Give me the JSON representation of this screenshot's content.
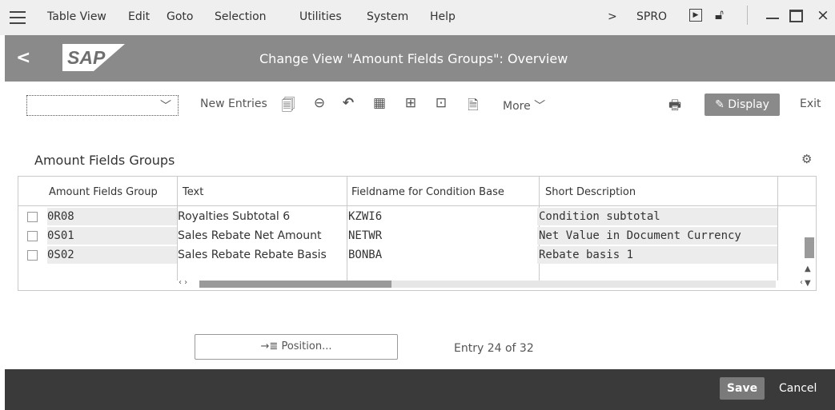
{
  "menu": {
    "items": [
      "Table View",
      "Edit",
      "Goto",
      "Selection",
      "Utilities",
      "System",
      "Help"
    ],
    "tcode": "SPRO",
    "chevron": ">"
  },
  "header": {
    "back": "<",
    "logo_text": "SAP",
    "title": "Change View \"Amount Fields Groups\": Overview"
  },
  "toolbar": {
    "new_entries": "New Entries",
    "more": "More",
    "display": "Display",
    "exit": "Exit",
    "select_value": ""
  },
  "section": {
    "title": "Amount Fields Groups"
  },
  "table": {
    "columns": [
      "Amount Fields Group",
      "Text",
      "Fieldname for Condition Base",
      "Short Description"
    ],
    "rows": [
      {
        "group": "0R08",
        "text": "Royalties Subtotal 6",
        "field": "KZWI6",
        "desc": "Condition subtotal"
      },
      {
        "group": "0S01",
        "text": "Sales Rebate Net Amount",
        "field": "NETWR",
        "desc": "Net Value in Document Currency"
      },
      {
        "group": "0S02",
        "text": "Sales Rebate Rebate Basis",
        "field": "BONBA",
        "desc": "Rebate basis 1"
      }
    ]
  },
  "position_button": "Position...",
  "entry_info": "Entry 24 of 32",
  "footer": {
    "save": "Save",
    "cancel": "Cancel"
  },
  "colors": {
    "title_bar": "#8a8a8a",
    "footer": "#3a3a3a",
    "menubar": "#efefef"
  }
}
